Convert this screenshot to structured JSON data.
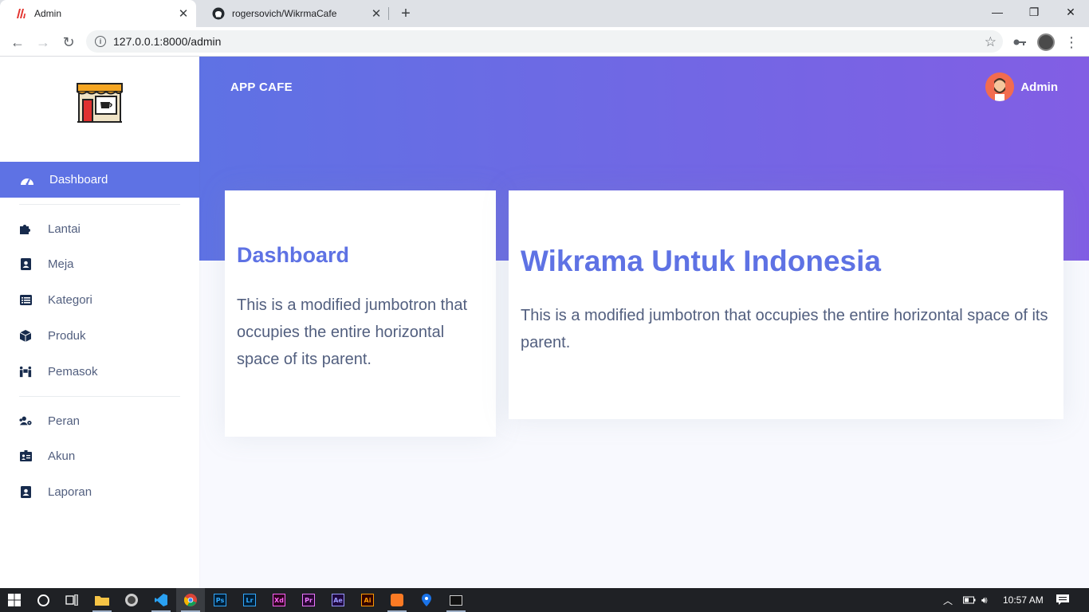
{
  "browser": {
    "tabs": [
      {
        "title": "Admin",
        "active": true
      },
      {
        "title": "rogersovich/WikrmaCafe",
        "active": false
      }
    ],
    "url": "127.0.0.1:8000/admin"
  },
  "sidebar": {
    "active_item": {
      "label": "Dashboard",
      "icon": "dashboard-gauge-icon"
    },
    "group1": [
      {
        "label": "Lantai",
        "icon": "puzzle-icon"
      },
      {
        "label": "Meja",
        "icon": "address-book-icon"
      },
      {
        "label": "Kategori",
        "icon": "list-alt-icon"
      },
      {
        "label": "Produk",
        "icon": "cube-icon"
      },
      {
        "label": "Pemasok",
        "icon": "people-carry-icon"
      }
    ],
    "group2": [
      {
        "label": "Peran",
        "icon": "users-cog-icon"
      },
      {
        "label": "Akun",
        "icon": "id-card-icon"
      },
      {
        "label": "Laporan",
        "icon": "address-book-icon"
      }
    ]
  },
  "header": {
    "brand": "APP CAFE",
    "user_name": "Admin"
  },
  "cards": [
    {
      "title": "Dashboard",
      "text": "This is a modified jumbotron that occupies the entire horizontal space of its parent."
    },
    {
      "title": "Wikrama Untuk Indonesia",
      "text": "This is a modified jumbotron that occupies the entire horizontal space of its parent."
    }
  ],
  "taskbar": {
    "clock": "10:57 AM",
    "apps": [
      "windows-start",
      "cortana",
      "task-view",
      "file-explorer",
      "obs",
      "vscode",
      "chrome",
      "photoshop",
      "lightroom",
      "xd",
      "premiere",
      "after-effects",
      "illustrator",
      "xampp",
      "maps",
      "terminal"
    ]
  },
  "colors": {
    "primary": "#5e72e4",
    "gradient_end": "#825ee4",
    "text_muted": "#525f7f"
  }
}
